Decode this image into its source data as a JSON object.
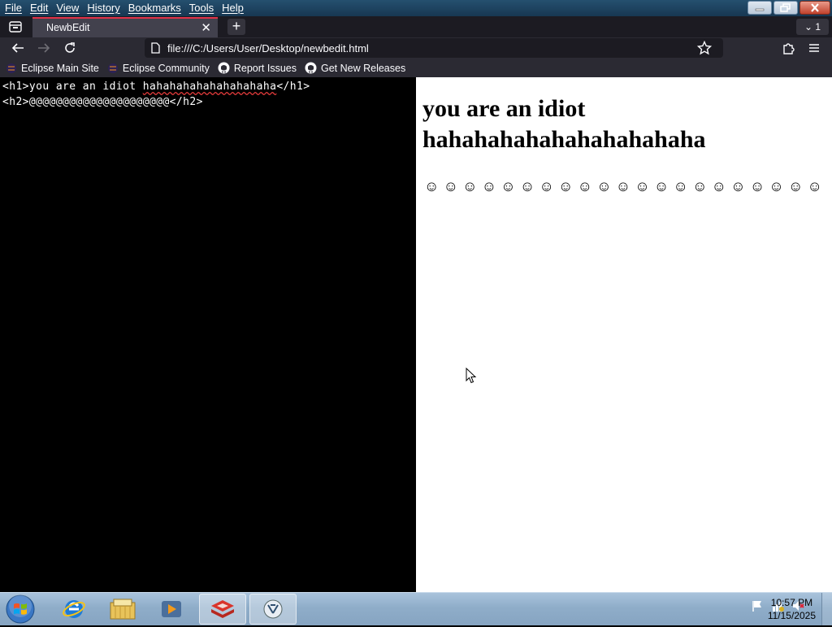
{
  "menubar": {
    "items": [
      "File",
      "Edit",
      "View",
      "History",
      "Bookmarks",
      "Tools",
      "Help"
    ]
  },
  "tab": {
    "title": "NewbEdit",
    "count": "1"
  },
  "urlbar": {
    "url": "file:///C:/Users/User/Desktop/newbedit.html"
  },
  "bookmarks": [
    {
      "label": "Eclipse Main Site",
      "icon": "eclipse-icon"
    },
    {
      "label": "Eclipse Community",
      "icon": "eclipse-icon"
    },
    {
      "label": "Report Issues",
      "icon": "github-icon"
    },
    {
      "label": "Get New Releases",
      "icon": "github-icon"
    }
  ],
  "editor": {
    "line1_before": "<h1>you are an idiot ",
    "line1_squiggle": "hahahahahahahahahaha",
    "line1_after": "</h1>",
    "line2": "<h2>@@@@@@@@@@@@@@@@@@@@@</h2>"
  },
  "preview": {
    "h1": "you are an idiot hahahahahahahahahahaha",
    "h2": "☺☺☺☺☺☺☺☺☺☺☺☺☺☺☺☺☺☺☺☺☺"
  },
  "taskbar": {
    "apps": [
      "internet-explorer-icon",
      "file-explorer-icon",
      "media-player-icon",
      "firefox-icon",
      "app-icon"
    ],
    "clock_time": "10:57 PM",
    "clock_date": "11/15/2025"
  },
  "colors": {
    "tab_accent": "#e0324a",
    "chrome_dark": "#2b2a33",
    "editor_bg": "#000000",
    "preview_bg": "#ffffff"
  }
}
